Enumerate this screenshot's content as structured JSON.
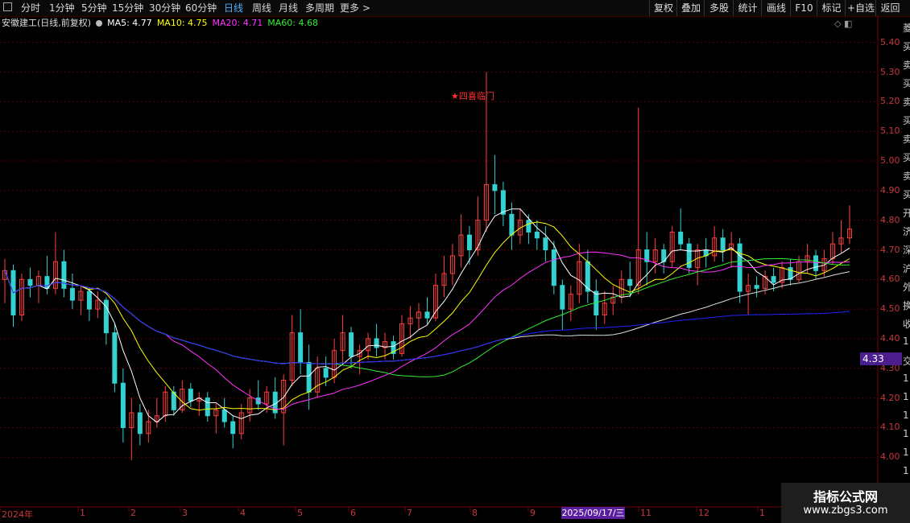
{
  "toolbar": {
    "periods": [
      {
        "label": "分时"
      },
      {
        "label": "1分钟"
      },
      {
        "label": "5分钟"
      },
      {
        "label": "15分钟"
      },
      {
        "label": "30分钟"
      },
      {
        "label": "60分钟"
      },
      {
        "label": "日线"
      },
      {
        "label": "周线"
      },
      {
        "label": "月线"
      },
      {
        "label": "多周期"
      },
      {
        "label": "更多 >"
      }
    ],
    "active_period": "日线",
    "right_buttons": [
      {
        "label": "复权"
      },
      {
        "label": "叠加"
      },
      {
        "label": "多股"
      },
      {
        "label": "统计"
      },
      {
        "label": "画线"
      },
      {
        "label": "F10"
      },
      {
        "label": "标记"
      },
      {
        "label": "+自选"
      },
      {
        "label": "返回"
      }
    ]
  },
  "legend": {
    "title": "安徽建工(日线,前复权)",
    "ma5": "MA5: 4.77",
    "ma10": "MA10: 4.75",
    "ma20": "MA20: 4.71",
    "ma60": "MA60: 4.68",
    "colors": {
      "ma5": "#ffffff",
      "ma10": "#ffff00",
      "ma20": "#ff33ff",
      "ma60": "#33ee33",
      "ma120": "#dddddd",
      "ma250": "#2222ff"
    }
  },
  "chart_data": {
    "type": "candlestick",
    "y_ticks": [
      "5.40",
      "5.30",
      "5.20",
      "5.10",
      "5.00",
      "4.90",
      "4.80",
      "4.70",
      "4.60",
      "4.50",
      "4.40",
      "4.30",
      "4.20",
      "4.10",
      "4.00"
    ],
    "ylim": [
      3.96,
      5.44
    ],
    "x_labels": [
      "2024年",
      "1",
      "2",
      "3",
      "4",
      "5",
      "6",
      "7",
      "8",
      "9",
      "11",
      "12",
      "1"
    ],
    "annotation": "四喜临门",
    "current_price": "4.33",
    "selected_date": "2025/09/17/三",
    "colors": {
      "up": "#ff4040",
      "down": "#34d1d1",
      "grid": "#5a0000"
    },
    "candles": [
      {
        "o": 4.6,
        "h": 4.67,
        "l": 4.52,
        "c": 4.63
      },
      {
        "o": 4.63,
        "h": 4.65,
        "l": 4.44,
        "c": 4.48
      },
      {
        "o": 4.48,
        "h": 4.62,
        "l": 4.46,
        "c": 4.6
      },
      {
        "o": 4.6,
        "h": 4.64,
        "l": 4.54,
        "c": 4.58
      },
      {
        "o": 4.58,
        "h": 4.63,
        "l": 4.52,
        "c": 4.61
      },
      {
        "o": 4.61,
        "h": 4.68,
        "l": 4.55,
        "c": 4.57
      },
      {
        "o": 4.57,
        "h": 4.76,
        "l": 4.55,
        "c": 4.66
      },
      {
        "o": 4.66,
        "h": 4.7,
        "l": 4.54,
        "c": 4.57
      },
      {
        "o": 4.57,
        "h": 4.62,
        "l": 4.5,
        "c": 4.53
      },
      {
        "o": 4.53,
        "h": 4.58,
        "l": 4.48,
        "c": 4.56
      },
      {
        "o": 4.56,
        "h": 4.57,
        "l": 4.46,
        "c": 4.5
      },
      {
        "o": 4.5,
        "h": 4.56,
        "l": 4.47,
        "c": 4.53
      },
      {
        "o": 4.53,
        "h": 4.54,
        "l": 4.38,
        "c": 4.42
      },
      {
        "o": 4.42,
        "h": 4.45,
        "l": 4.22,
        "c": 4.25
      },
      {
        "o": 4.25,
        "h": 4.3,
        "l": 4.05,
        "c": 4.1
      },
      {
        "o": 4.1,
        "h": 4.2,
        "l": 3.99,
        "c": 4.15
      },
      {
        "o": 4.15,
        "h": 4.18,
        "l": 4.04,
        "c": 4.08
      },
      {
        "o": 4.08,
        "h": 4.16,
        "l": 4.05,
        "c": 4.12
      },
      {
        "o": 4.12,
        "h": 4.2,
        "l": 4.1,
        "c": 4.14
      },
      {
        "o": 4.14,
        "h": 4.24,
        "l": 4.12,
        "c": 4.22
      },
      {
        "o": 4.22,
        "h": 4.24,
        "l": 4.14,
        "c": 4.16
      },
      {
        "o": 4.16,
        "h": 4.26,
        "l": 4.15,
        "c": 4.23
      },
      {
        "o": 4.23,
        "h": 4.25,
        "l": 4.17,
        "c": 4.19
      },
      {
        "o": 4.19,
        "h": 4.22,
        "l": 4.14,
        "c": 4.2
      },
      {
        "o": 4.2,
        "h": 4.22,
        "l": 4.12,
        "c": 4.14
      },
      {
        "o": 4.14,
        "h": 4.18,
        "l": 4.08,
        "c": 4.16
      },
      {
        "o": 4.16,
        "h": 4.2,
        "l": 4.1,
        "c": 4.12
      },
      {
        "o": 4.12,
        "h": 4.14,
        "l": 4.03,
        "c": 4.08
      },
      {
        "o": 4.08,
        "h": 4.18,
        "l": 4.06,
        "c": 4.15
      },
      {
        "o": 4.15,
        "h": 4.23,
        "l": 4.12,
        "c": 4.2
      },
      {
        "o": 4.2,
        "h": 4.26,
        "l": 4.16,
        "c": 4.18
      },
      {
        "o": 4.18,
        "h": 4.24,
        "l": 4.15,
        "c": 4.22
      },
      {
        "o": 4.22,
        "h": 4.27,
        "l": 4.13,
        "c": 4.15
      },
      {
        "o": 4.15,
        "h": 4.28,
        "l": 4.04,
        "c": 4.26
      },
      {
        "o": 4.26,
        "h": 4.48,
        "l": 4.24,
        "c": 4.42
      },
      {
        "o": 4.42,
        "h": 4.5,
        "l": 4.28,
        "c": 4.32
      },
      {
        "o": 4.32,
        "h": 4.38,
        "l": 4.16,
        "c": 4.22
      },
      {
        "o": 4.22,
        "h": 4.34,
        "l": 4.2,
        "c": 4.3
      },
      {
        "o": 4.3,
        "h": 4.34,
        "l": 4.24,
        "c": 4.27
      },
      {
        "o": 4.27,
        "h": 4.4,
        "l": 4.25,
        "c": 4.36
      },
      {
        "o": 4.36,
        "h": 4.48,
        "l": 4.32,
        "c": 4.42
      },
      {
        "o": 4.42,
        "h": 4.44,
        "l": 4.3,
        "c": 4.34
      },
      {
        "o": 4.34,
        "h": 4.38,
        "l": 4.28,
        "c": 4.36
      },
      {
        "o": 4.36,
        "h": 4.42,
        "l": 4.33,
        "c": 4.4
      },
      {
        "o": 4.4,
        "h": 4.45,
        "l": 4.34,
        "c": 4.37
      },
      {
        "o": 4.37,
        "h": 4.42,
        "l": 4.33,
        "c": 4.39
      },
      {
        "o": 4.39,
        "h": 4.41,
        "l": 4.33,
        "c": 4.35
      },
      {
        "o": 4.35,
        "h": 4.48,
        "l": 4.34,
        "c": 4.45
      },
      {
        "o": 4.45,
        "h": 4.51,
        "l": 4.4,
        "c": 4.47
      },
      {
        "o": 4.47,
        "h": 4.52,
        "l": 4.43,
        "c": 4.49
      },
      {
        "o": 4.49,
        "h": 4.54,
        "l": 4.45,
        "c": 4.47
      },
      {
        "o": 4.47,
        "h": 4.62,
        "l": 4.46,
        "c": 4.58
      },
      {
        "o": 4.58,
        "h": 4.68,
        "l": 4.54,
        "c": 4.62
      },
      {
        "o": 4.62,
        "h": 4.72,
        "l": 4.58,
        "c": 4.68
      },
      {
        "o": 4.68,
        "h": 4.82,
        "l": 4.64,
        "c": 4.75
      },
      {
        "o": 4.75,
        "h": 4.78,
        "l": 4.65,
        "c": 4.7
      },
      {
        "o": 4.7,
        "h": 4.88,
        "l": 4.68,
        "c": 4.8
      },
      {
        "o": 4.8,
        "h": 5.3,
        "l": 4.76,
        "c": 4.92
      },
      {
        "o": 4.92,
        "h": 5.02,
        "l": 4.82,
        "c": 4.9
      },
      {
        "o": 4.9,
        "h": 4.93,
        "l": 4.78,
        "c": 4.82
      },
      {
        "o": 4.82,
        "h": 4.86,
        "l": 4.7,
        "c": 4.75
      },
      {
        "o": 4.75,
        "h": 4.84,
        "l": 4.72,
        "c": 4.8
      },
      {
        "o": 4.8,
        "h": 4.82,
        "l": 4.72,
        "c": 4.76
      },
      {
        "o": 4.76,
        "h": 4.8,
        "l": 4.7,
        "c": 4.74
      },
      {
        "o": 4.74,
        "h": 4.78,
        "l": 4.66,
        "c": 4.7
      },
      {
        "o": 4.7,
        "h": 4.73,
        "l": 4.55,
        "c": 4.58
      },
      {
        "o": 4.58,
        "h": 4.6,
        "l": 4.43,
        "c": 4.5
      },
      {
        "o": 4.5,
        "h": 4.58,
        "l": 4.46,
        "c": 4.55
      },
      {
        "o": 4.55,
        "h": 4.72,
        "l": 4.52,
        "c": 4.66
      },
      {
        "o": 4.66,
        "h": 4.7,
        "l": 4.52,
        "c": 4.56
      },
      {
        "o": 4.56,
        "h": 4.6,
        "l": 4.43,
        "c": 4.48
      },
      {
        "o": 4.48,
        "h": 4.56,
        "l": 4.45,
        "c": 4.52
      },
      {
        "o": 4.52,
        "h": 4.58,
        "l": 4.48,
        "c": 4.54
      },
      {
        "o": 4.54,
        "h": 4.63,
        "l": 4.52,
        "c": 4.6
      },
      {
        "o": 4.6,
        "h": 4.66,
        "l": 4.54,
        "c": 4.58
      },
      {
        "o": 4.58,
        "h": 5.18,
        "l": 4.55,
        "c": 4.7
      },
      {
        "o": 4.7,
        "h": 4.76,
        "l": 4.58,
        "c": 4.66
      },
      {
        "o": 4.66,
        "h": 4.74,
        "l": 4.62,
        "c": 4.7
      },
      {
        "o": 4.7,
        "h": 4.72,
        "l": 4.62,
        "c": 4.66
      },
      {
        "o": 4.66,
        "h": 4.78,
        "l": 4.64,
        "c": 4.76
      },
      {
        "o": 4.76,
        "h": 4.84,
        "l": 4.7,
        "c": 4.72
      },
      {
        "o": 4.72,
        "h": 4.74,
        "l": 4.62,
        "c": 4.64
      },
      {
        "o": 4.64,
        "h": 4.72,
        "l": 4.58,
        "c": 4.7
      },
      {
        "o": 4.7,
        "h": 4.74,
        "l": 4.64,
        "c": 4.68
      },
      {
        "o": 4.68,
        "h": 4.78,
        "l": 4.66,
        "c": 4.74
      },
      {
        "o": 4.74,
        "h": 4.77,
        "l": 4.66,
        "c": 4.7
      },
      {
        "o": 4.7,
        "h": 4.76,
        "l": 4.64,
        "c": 4.72
      },
      {
        "o": 4.72,
        "h": 4.74,
        "l": 4.52,
        "c": 4.56
      },
      {
        "o": 4.56,
        "h": 4.62,
        "l": 4.48,
        "c": 4.58
      },
      {
        "o": 4.58,
        "h": 4.61,
        "l": 4.54,
        "c": 4.57
      },
      {
        "o": 4.57,
        "h": 4.63,
        "l": 4.55,
        "c": 4.61
      },
      {
        "o": 4.61,
        "h": 4.64,
        "l": 4.56,
        "c": 4.59
      },
      {
        "o": 4.59,
        "h": 4.66,
        "l": 4.57,
        "c": 4.64
      },
      {
        "o": 4.64,
        "h": 4.67,
        "l": 4.58,
        "c": 4.6
      },
      {
        "o": 4.6,
        "h": 4.68,
        "l": 4.59,
        "c": 4.66
      },
      {
        "o": 4.66,
        "h": 4.72,
        "l": 4.62,
        "c": 4.68
      },
      {
        "o": 4.68,
        "h": 4.7,
        "l": 4.6,
        "c": 4.63
      },
      {
        "o": 4.63,
        "h": 4.7,
        "l": 4.61,
        "c": 4.67
      },
      {
        "o": 4.67,
        "h": 4.76,
        "l": 4.65,
        "c": 4.72
      },
      {
        "o": 4.72,
        "h": 4.8,
        "l": 4.69,
        "c": 4.74
      },
      {
        "o": 4.74,
        "h": 4.85,
        "l": 4.72,
        "c": 4.77
      }
    ]
  },
  "right_strip_chars": [
    "菱",
    "买",
    "卖",
    "买",
    "卖",
    "买",
    "卖",
    "买",
    "卖",
    "买",
    "开",
    "济",
    "深",
    "沪",
    "外",
    "换",
    "收",
    "1",
    "交",
    "1",
    "1",
    "1",
    "1",
    "1",
    "1"
  ],
  "watermark": {
    "title": "指标公式网",
    "url": "www.zbgs3.com"
  },
  "window_icons": "◇ ◧"
}
